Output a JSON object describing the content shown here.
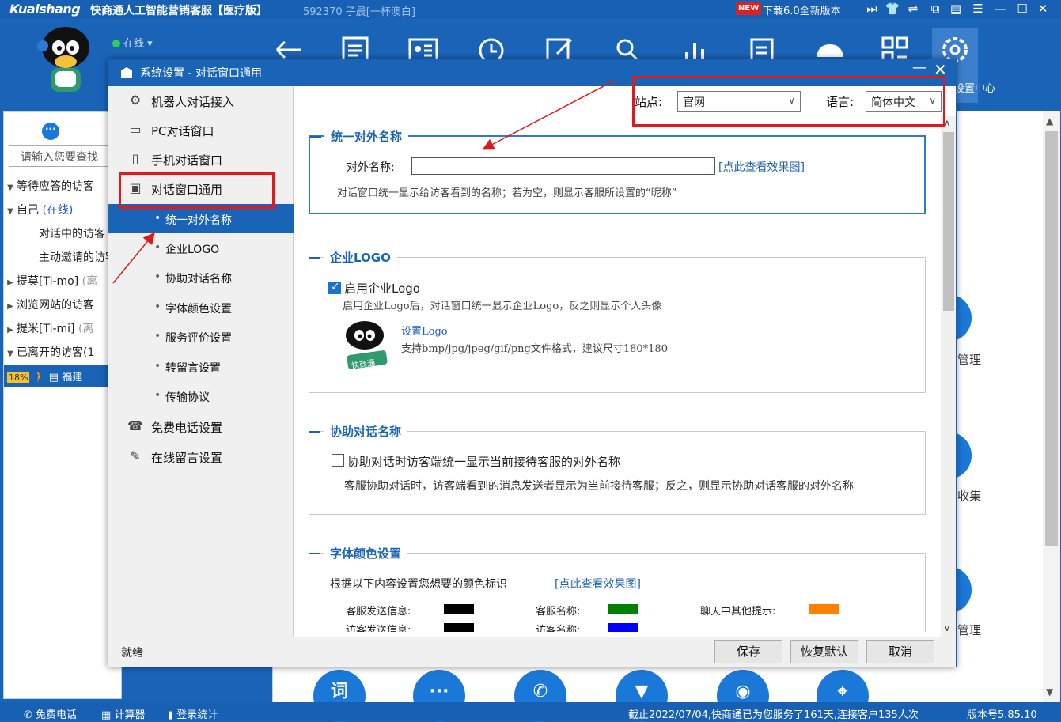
{
  "titlebar": {
    "brand": "Kuaishang",
    "app_title": "快商通人工智能营销客服【医疗版】",
    "user_info": "592370 子晨[一杯澳白]",
    "new_badge": "NEW",
    "download_text": "下载6.0全新版本"
  },
  "toolbar": {
    "status": "在线",
    "settings_label": "设置中心"
  },
  "left_panel": {
    "search_placeholder": "请输入您要查找",
    "items": [
      {
        "label": "等待应答的访客"
      },
      {
        "label": "自己",
        "suffix": "(在线)"
      },
      {
        "label": "对话中的访客"
      },
      {
        "label": "主动邀请的访客"
      },
      {
        "label": "提莫[Ti-mo]",
        "suffix": "(离"
      },
      {
        "label": "浏览网站的访客"
      },
      {
        "label": "提米[Ti-mi]",
        "suffix": "(离"
      },
      {
        "label": "已离开的访客(1"
      }
    ],
    "selected_row": {
      "percent": "18%",
      "name": "福建"
    }
  },
  "background_labels": {
    "label1": "管理",
    "label2": "收集",
    "label3": "管理"
  },
  "dialog": {
    "title": "系统设置 - 对话窗口通用",
    "side_menu": [
      {
        "label": "机器人对话接入",
        "icon": "robot-icon"
      },
      {
        "label": "PC对话窗口",
        "icon": "monitor-icon"
      },
      {
        "label": "手机对话窗口",
        "icon": "phone-icon"
      },
      {
        "label": "对话窗口通用",
        "icon": "chat-bubble-icon"
      }
    ],
    "sub_menu": [
      {
        "label": "统一对外名称",
        "selected": true
      },
      {
        "label": "企业LOGO"
      },
      {
        "label": "协助对话名称"
      },
      {
        "label": "字体颜色设置"
      },
      {
        "label": "服务评价设置"
      },
      {
        "label": "转留言设置"
      },
      {
        "label": "传输协议"
      }
    ],
    "side_menu_bottom": [
      {
        "label": "免费电话设置",
        "icon": "telephone-icon"
      },
      {
        "label": "在线留言设置",
        "icon": "edit-note-icon"
      }
    ],
    "site_label": "站点:",
    "site_value": "官网",
    "language_label": "语言:",
    "language_value": "简体中文",
    "sections": {
      "unified_name": {
        "legend": "统一对外名称",
        "field_label": "对外名称:",
        "field_value": "",
        "preview_link": "[点此查看效果图]",
        "desc": "对话窗口统一显示给访客看到的名称；若为空，则显示客服所设置的“昵称”"
      },
      "logo": {
        "legend": "企业LOGO",
        "enable_label": "启用企业Logo",
        "enable_checked": true,
        "enable_desc": "启用企业Logo后，对话窗口统一显示企业Logo，反之则显示个人头像",
        "set_logo_link": "设置Logo",
        "format_desc": "支持bmp/jpg/jpeg/gif/png文件格式，建议尺寸180*180",
        "logo_caption": "快商通"
      },
      "assist_name": {
        "legend": "协助对话名称",
        "option_label": "协助对话时访客端统一显示当前接待客服的对外名称",
        "option_checked": false,
        "desc": "客服协助对话时，访客端看到的消息发送者显示为当前接待客服；反之，则显示协助对话客服的对外名称"
      },
      "font_color": {
        "legend": "字体颜色设置",
        "intro": "根据以下内容设置您想要的颜色标识",
        "preview_link": "[点此查看效果图]",
        "items": [
          {
            "label": "客服发送信息:",
            "color": "#000000"
          },
          {
            "label": "客服名称:",
            "color": "#008000"
          },
          {
            "label": "聊天中其他提示:",
            "color": "#ff8000"
          },
          {
            "label": "访客发送信息:",
            "color": "#000000"
          },
          {
            "label": "访客名称:",
            "color": "#0000ff"
          }
        ]
      }
    },
    "footer": {
      "status": "就绪",
      "save": "保存",
      "restore": "恢复默认",
      "cancel": "取消"
    }
  },
  "statusbar": {
    "free_call": "免费电话",
    "calculator": "计算器",
    "login_stats": "登录统计",
    "service_info": "截止2022/07/04,快商通已为您服务了161天,连接客户135人次",
    "version": "版本号5.85.10"
  },
  "colors": {
    "brand_blue": "#1a64b8",
    "highlight_red": "#e01a1a"
  }
}
